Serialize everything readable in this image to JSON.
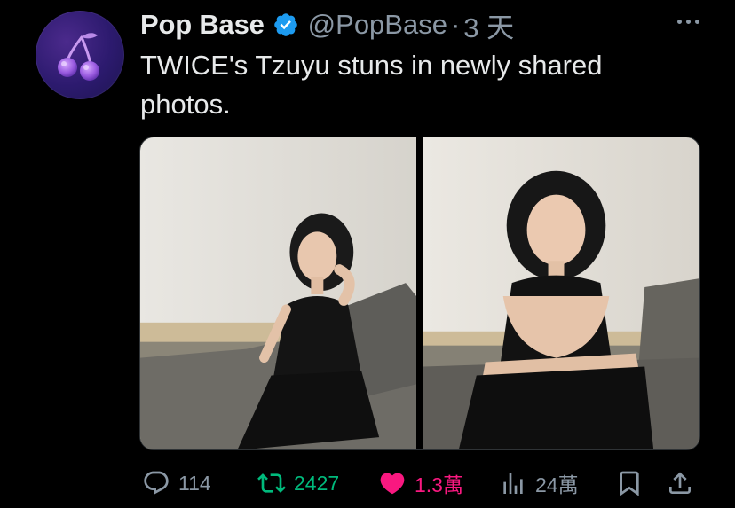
{
  "author": {
    "name": "Pop Base",
    "handle": "@PopBase",
    "separator": "·",
    "time": "3 天",
    "verified": true,
    "avatar_icon": "cherries-icon"
  },
  "tweet": {
    "text": "TWICE's Tzuyu stuns in newly shared photos."
  },
  "media": {
    "photos": [
      {
        "name": "photo-1",
        "description": "woman in black dress seated on grey sofa, hand on chin"
      },
      {
        "name": "photo-2",
        "description": "woman in black dress leaning on grey sofa armrest"
      }
    ]
  },
  "actions": {
    "reply": {
      "icon": "reply-icon",
      "count": "114"
    },
    "retweet": {
      "icon": "retweet-icon",
      "count": "2427"
    },
    "like": {
      "icon": "heart-icon",
      "count": "1.3萬",
      "liked": true
    },
    "views": {
      "icon": "views-icon",
      "count": "24萬"
    },
    "bookmark": {
      "icon": "bookmark-icon"
    },
    "share": {
      "icon": "share-icon"
    }
  },
  "colors": {
    "background": "#000000",
    "text": "#e7e9ea",
    "muted": "#8b98a5",
    "verified": "#1d9bf0",
    "retweet": "#00ba7c",
    "like": "#f91880"
  }
}
